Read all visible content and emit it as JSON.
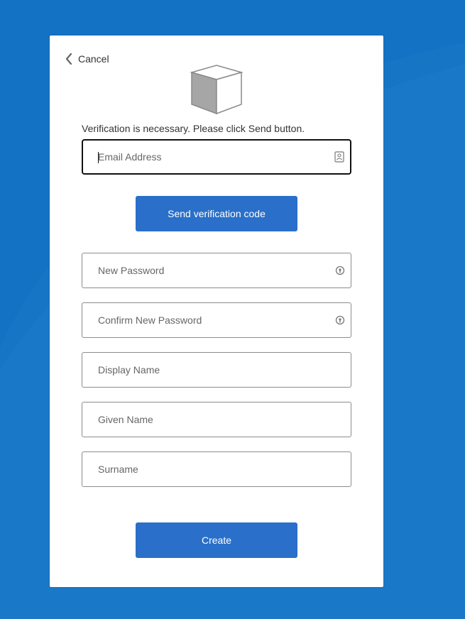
{
  "colors": {
    "background": "#1472c4",
    "card": "#ffffff",
    "button": "#2a6fc9",
    "input_border": "#8c8c8c",
    "input_border_focused": "#111111"
  },
  "header": {
    "cancel_label": "Cancel",
    "cancel_icon": "chevron-left-icon",
    "logo_icon": "cube-logo-icon"
  },
  "intro_text": "Verification is necessary. Please click Send button.",
  "fields": {
    "email": {
      "placeholder": "Email Address",
      "value": "",
      "icon": "contact-card-icon",
      "focused": true
    },
    "new_password": {
      "placeholder": "New Password",
      "value": "",
      "icon": "password-reveal-icon"
    },
    "confirm_password": {
      "placeholder": "Confirm New Password",
      "value": "",
      "icon": "password-reveal-icon"
    },
    "display_name": {
      "placeholder": "Display Name",
      "value": ""
    },
    "given_name": {
      "placeholder": "Given Name",
      "value": ""
    },
    "surname": {
      "placeholder": "Surname",
      "value": ""
    }
  },
  "buttons": {
    "send_code_label": "Send verification code",
    "create_label": "Create"
  }
}
